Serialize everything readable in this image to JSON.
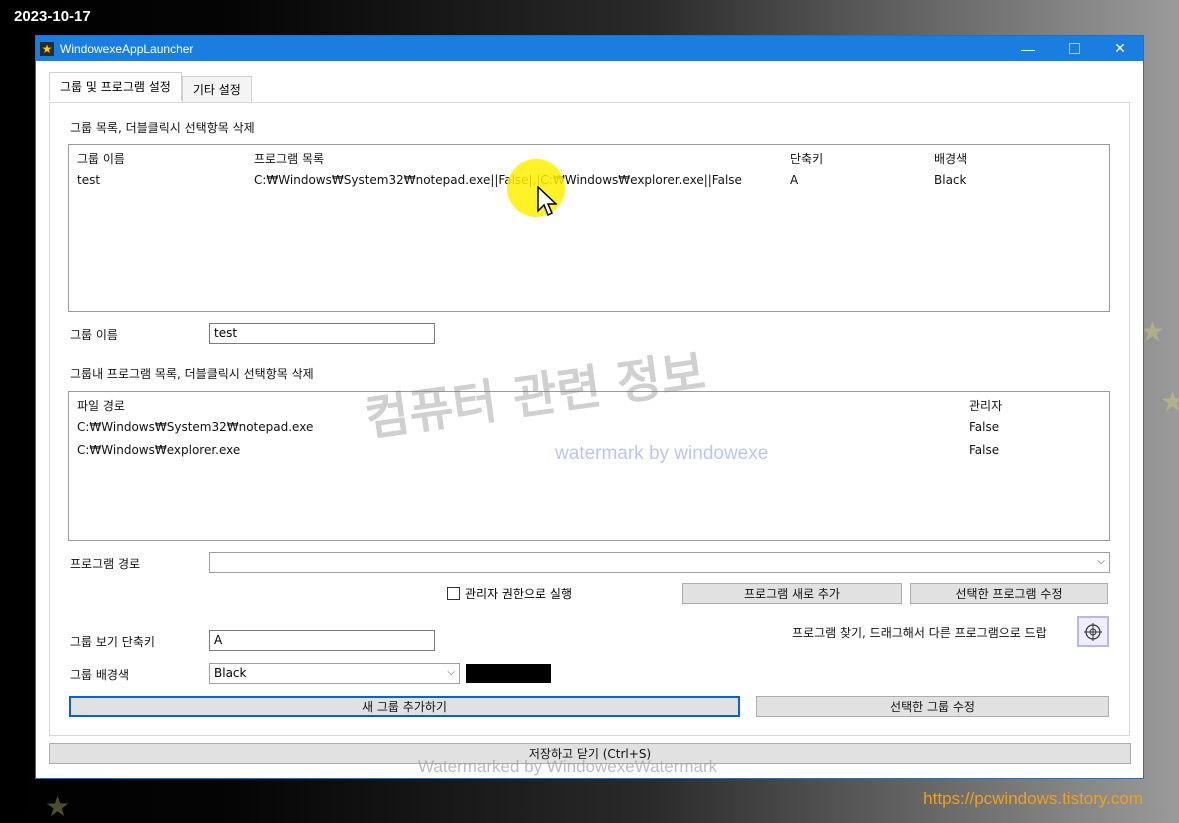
{
  "overlay": {
    "date": "2023-10-17",
    "site_url": "https://pcwindows.tistory.com",
    "watermark_main": "컴퓨터 관련 정보",
    "watermark_sub": "watermark by windowexe",
    "watermark_bottom": "Watermarked by WindowexeWatermark"
  },
  "window": {
    "title": "WindowexeAppLauncher",
    "icons": {
      "app": "star-icon",
      "minimize": "minimize-icon",
      "maximize": "maximize-icon",
      "close": "close-icon"
    }
  },
  "tabs": [
    {
      "label": "그룹 및 프로그램 설정",
      "active": true
    },
    {
      "label": "기타 설정",
      "active": false
    }
  ],
  "group_list": {
    "caption": "그룹 목록, 더블클릭시 선택항목 삭제",
    "columns": [
      "그룹 이름",
      "프로그램 목록",
      "단축키",
      "배경색"
    ],
    "rows": [
      [
        "test",
        "C:₩Windows₩System32₩notepad.exe||False|,|C:₩Windows₩explorer.exe||False",
        "A",
        "Black"
      ]
    ]
  },
  "group_name": {
    "label": "그룹 이름",
    "value": "test"
  },
  "program_list": {
    "caption": "그룹내 프로그램 목록, 더블클릭시 선택항목 삭제",
    "columns": [
      "파일 경로",
      "관리자"
    ],
    "rows": [
      [
        "C:₩Windows₩System32₩notepad.exe",
        "False"
      ],
      [
        "C:₩Windows₩explorer.exe",
        "False"
      ]
    ]
  },
  "program_path": {
    "label": "프로그램 경로",
    "value": ""
  },
  "run_as_admin": {
    "label": "관리자 권한으로 실행",
    "checked": false
  },
  "buttons": {
    "add_program": "프로그램 새로 추가",
    "edit_program": "선택한 프로그램 수정",
    "add_group": "새 그룹 추가하기",
    "edit_group": "선택한 그룹 수정",
    "save_close": "저장하고 닫기 (Ctrl+S)"
  },
  "finder": {
    "label": "프로그램 찾기, 드래그해서 다른 프로그램으로 드랍",
    "icon": "crosshair-icon"
  },
  "hotkey": {
    "label": "그룹 보기 단축키",
    "value": "A"
  },
  "background": {
    "label": "그룹 배경색",
    "value": "Black",
    "swatch_color": "#000000"
  }
}
